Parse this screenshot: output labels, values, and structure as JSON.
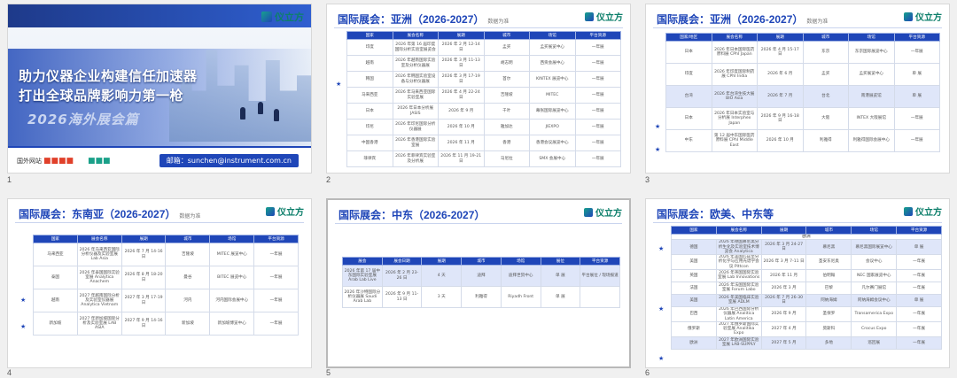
{
  "slides": [
    {
      "number": "1"
    },
    {
      "number": "2",
      "title": "国际展会：亚洲（2026-2027）",
      "subtitle": "数据为准"
    },
    {
      "number": "3",
      "title": "国际展会：亚洲（2026-2027）",
      "subtitle": "数据为准"
    },
    {
      "number": "4",
      "title": "国际展会：东南亚（2026-2027）",
      "subtitle": "数据为准"
    },
    {
      "number": "5",
      "title": "国际展会：中东（2026-2027）",
      "subtitle": "数据为准"
    },
    {
      "number": "6",
      "title": "国际展会：欧美、中东等",
      "subtitle": ""
    }
  ],
  "cover": {
    "line1": "助力仪器企业构建信任加速器",
    "line2": "打出全球品牌影响力第一枪",
    "line3": "2026海外展会篇",
    "logo": "仪立方",
    "bottom_label": "国外网站",
    "email": "邮箱：sunchen@instrument.com.cn"
  },
  "brand": {
    "logo": "仪立方",
    "accent": "#1f46b8",
    "logo_color": "#0d7f6b"
  },
  "slide2": {
    "headers": [
      "国家",
      "展会名称",
      "展期",
      "城市",
      "场馆",
      "平台资源"
    ],
    "rows": [
      [
        "印度",
        "2026 年第 16 届印度国际分析实验室展览会",
        "2026 年 2 月 12-14 日",
        "孟买",
        "孟买展览中心",
        "一年展"
      ],
      [
        "越南",
        "2026 年越南国际实验室及分析仪器展",
        "2026 年 3 月 11-13 日",
        "胡志明",
        "西贡会展中心",
        "一年展"
      ],
      [
        "韩国",
        "2026 年韩国实验室设备与分析仪器展",
        "2026 年 3 月 17-19 日",
        "首尔",
        "KINTEX 展览中心",
        "一年展"
      ],
      [
        "马来西亚",
        "2026 年马来西亚国际实验室展",
        "2026 年 4 月 22-24 日",
        "吉隆坡",
        "MITEC",
        "一年展"
      ],
      [
        "日本",
        "2026 年日本分析展 JASIS",
        "2026 年 9 月",
        "千叶",
        "幕张国际展览中心",
        "一年展"
      ],
      [
        "印尼",
        "2026 年印尼国际分析仪器展",
        "2026 年 10 月",
        "雅加达",
        "JIEXPO",
        "一年展"
      ],
      [
        "中国香港",
        "2026 年香港国际实验室展",
        "2026 年 11 月",
        "香港",
        "香港会议展览中心",
        "一年展"
      ],
      [
        "菲律宾",
        "2026 年菲律宾实验室及分析展",
        "2026 年 11 月 19-21 日",
        "马尼拉",
        "SMX 会展中心",
        "一年展"
      ]
    ]
  },
  "slide3": {
    "headers": [
      "国家/地区",
      "展会名称",
      "展期",
      "城市",
      "场馆",
      "平台资源"
    ],
    "rows": [
      [
        "日本",
        "2026 年日本国际医药原料展 CPhI Japan",
        "2026 年 4 月 15-17 日",
        "东京",
        "东京国际展览中心",
        "一年展"
      ],
      [
        "印度",
        "2026 年印度国际制药展 CPhI India",
        "2026 年 6 月",
        "孟买",
        "孟买展览中心",
        "单 展"
      ],
      [
        "台湾",
        "2026 年台湾生技大展 BIO Asia",
        "2026 年 7 月",
        "台北",
        "南港展览馆",
        "单 展"
      ],
      [
        "日本",
        "2026 年日本实验室与分析展 Interphex Japan",
        "2026 年 9 月 16-18 日",
        "大阪",
        "INTEX 大阪展馆",
        "一年展"
      ],
      [
        "中东",
        "第 12 届中东国际医药原料展 CPhI Middle East",
        "2026 年 10 月",
        "利雅得",
        "利雅得国际会展中心",
        "一年展"
      ]
    ],
    "highlight_rows": [
      2
    ]
  },
  "slide4": {
    "headers": [
      "国家",
      "展会名称",
      "展期",
      "城市",
      "场馆",
      "平台资源"
    ],
    "rows": [
      [
        "马来西亚",
        "2026 年马来西亚国际分析仪器及实验室展 Lab Asia",
        "2026 年 7 月 14-16 日",
        "吉隆坡",
        "MITEC 展览中心",
        "一年展"
      ],
      [
        "泰国",
        "2026 年泰国国际实验室展 Analytica Anachem",
        "2026 年 8 月 18-20 日",
        "曼谷",
        "BITEC 展览中心",
        "一年展"
      ],
      [
        "越南",
        "2027 年越南国际分析及实验室仪器展 Analytica Vietnam",
        "2027 年 3 月 17-19 日",
        "河内",
        "河内国际会展中心",
        "一年展"
      ],
      [
        "新加坡",
        "2027 年新加坡国际分析及实验室展 LAB ASIA",
        "2027 年 9 月 14-16 日",
        "新加坡",
        "新加坡博览中心",
        "一年展"
      ]
    ]
  },
  "slide5": {
    "headers": [
      "展会",
      "展会日期",
      "展期",
      "城市",
      "场馆",
      "展位",
      "平台资源"
    ],
    "rows": [
      [
        "2026 年第 17 届中东国际实验室展 Arab Lab Live",
        "2026 年 2 月 23-26 日",
        "4 天",
        "迪拜",
        "迪拜世贸中心",
        "单 展",
        "平台展位 / 现场报道"
      ],
      [
        "2026 年沙特国际分析仪器展 Saudi Arab Lab",
        "2026 年 9 月 11-13 日",
        "3 天",
        "利雅得",
        "Riyadh Front",
        "单 展",
        ""
      ]
    ],
    "highlight_rows": [
      0
    ]
  },
  "slide6": {
    "headers": [
      "国家",
      "展会名称",
      "展期",
      "城市",
      "场馆",
      "平台资源"
    ],
    "group_label": "欧洲",
    "rows": [
      [
        "德国",
        "2026 年德国慕尼黑分析生化及实验室技术博览会 Analytica",
        "2026 年 3 月 24-27 日",
        "慕尼黑",
        "慕尼黑国际展览中心",
        "单 展"
      ],
      [
        "美国",
        "2026 年美国匹兹堡分析化学与应用光谱学会议 Pittcon",
        "2026 年 3 月 7-11 日",
        "圣安东尼奥",
        "会议中心",
        "一年展"
      ],
      [
        "英国",
        "2026 年英国国际实验室展 Lab Innovations",
        "2026 年 11 月",
        "伯明翰",
        "NEC 国家展览中心",
        "一年展"
      ],
      [
        "法国",
        "2026 年法国国际实验室展 Forum Labo",
        "2026 年 3 月",
        "巴黎",
        "凡尔赛门展馆",
        "一年展"
      ],
      [
        "美国",
        "2026 年美国临床实验室展 ADLM",
        "2026 年 7 月 26-30 日",
        "阿纳海姆",
        "阿纳海姆会议中心",
        "单 展"
      ],
      [
        "巴西",
        "2026 年巴西国际分析仪器展 Analitica Latin America",
        "2026 年 9 月",
        "圣保罗",
        "Transamerica Expo",
        "一年展"
      ],
      [
        "俄罗斯",
        "2027 年俄罗斯国际实验室展 Analitika Expo",
        "2027 年 4 月",
        "莫斯科",
        "Crocus Expo",
        "一年展"
      ],
      [
        "欧洲",
        "2027 年欧洲国际实验室展 LAB-SUPPLY",
        "2027 年 5 月",
        "多地",
        "巡回展",
        "一年展"
      ]
    ],
    "highlight_rows": [
      0,
      4,
      7
    ]
  }
}
